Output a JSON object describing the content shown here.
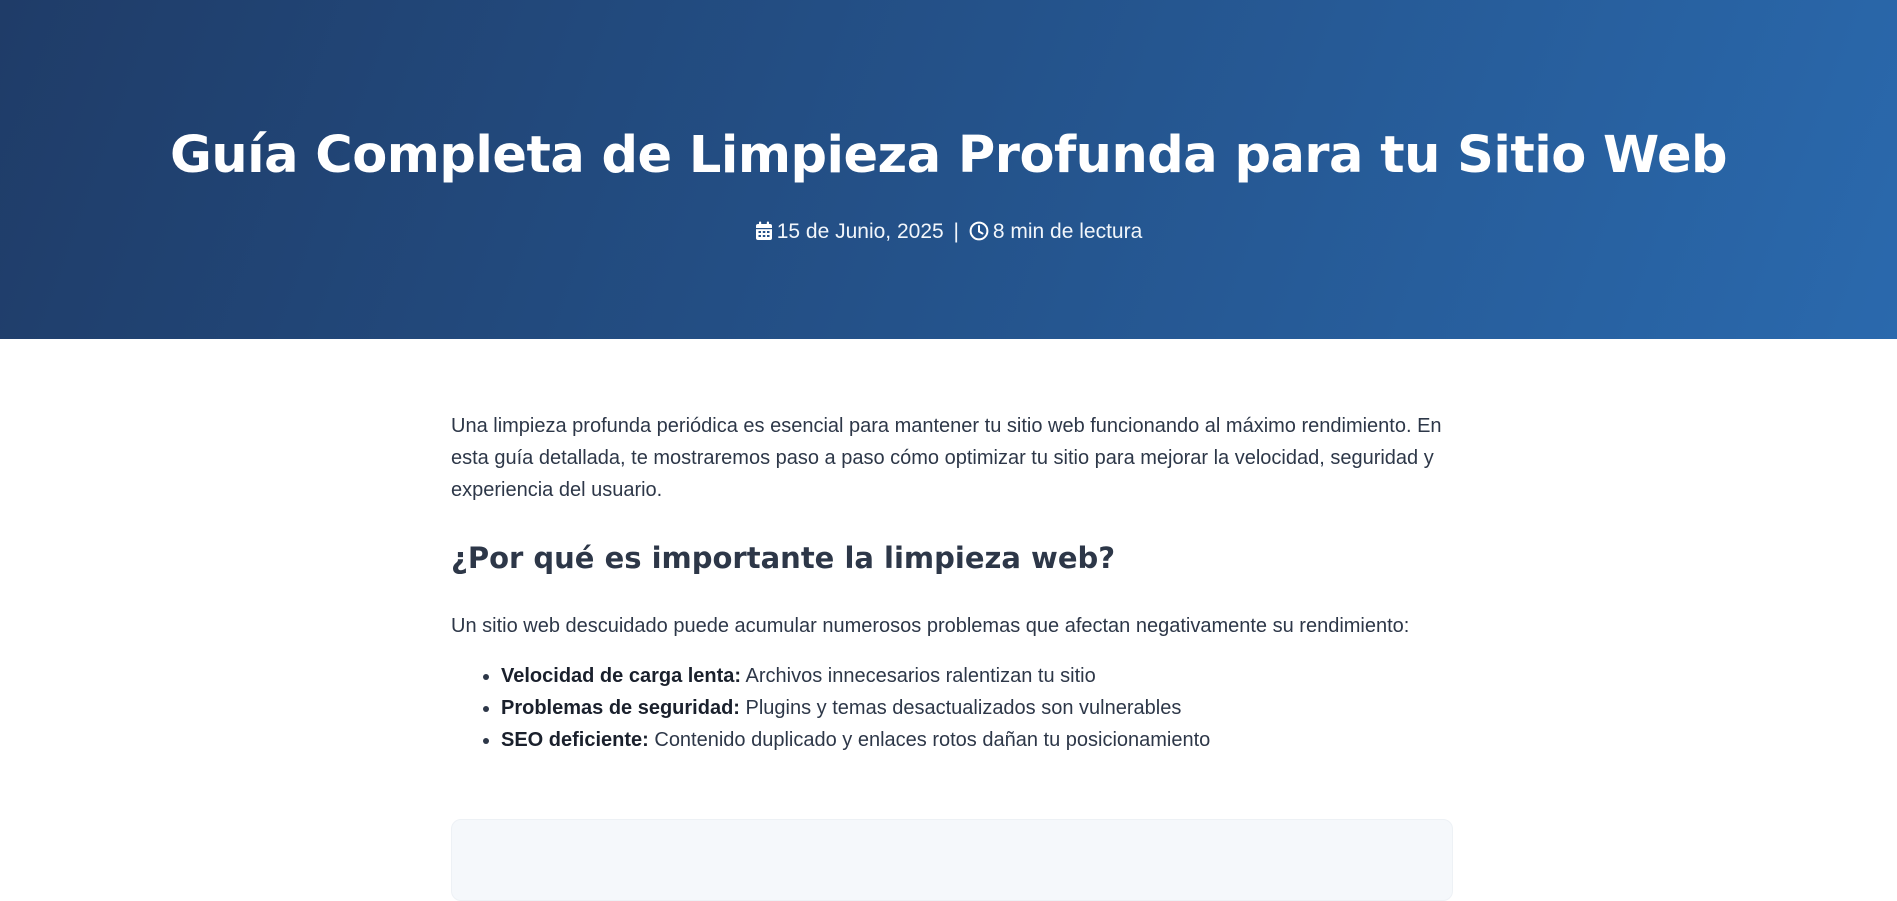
{
  "hero": {
    "title": "Guía Completa de Limpieza Profunda para tu Sitio Web",
    "date": "15 de Junio, 2025",
    "separator": "|",
    "read_time": "8 min de lectura",
    "icons": {
      "date": "calendar-icon",
      "read_time": "clock-icon"
    },
    "colors": {
      "gradient_start": "#1f3c68",
      "gradient_end": "#2a69ad"
    }
  },
  "article": {
    "intro": "Una limpieza profunda periódica es esencial para mantener tu sitio web funcionando al máximo rendimiento. En esta guía detallada, te mostraremos paso a paso cómo optimizar tu sitio para mejorar la velocidad, seguridad y experiencia del usuario.",
    "section_title": "¿Por qué es importante la limpieza web?",
    "section_paragraph": "Un sitio web descuidado puede acumular numerosos problemas que afectan negativamente su rendimiento:",
    "issues": [
      {
        "label": "Velocidad de carga lenta:",
        "text": " Archivos innecesarios ralentizan tu sitio"
      },
      {
        "label": "Problemas de seguridad:",
        "text": " Plugins y temas desactualizados son vulnerables"
      },
      {
        "label": "SEO deficiente:",
        "text": " Contenido duplicado y enlaces rotos dañan tu posicionamiento"
      }
    ]
  }
}
